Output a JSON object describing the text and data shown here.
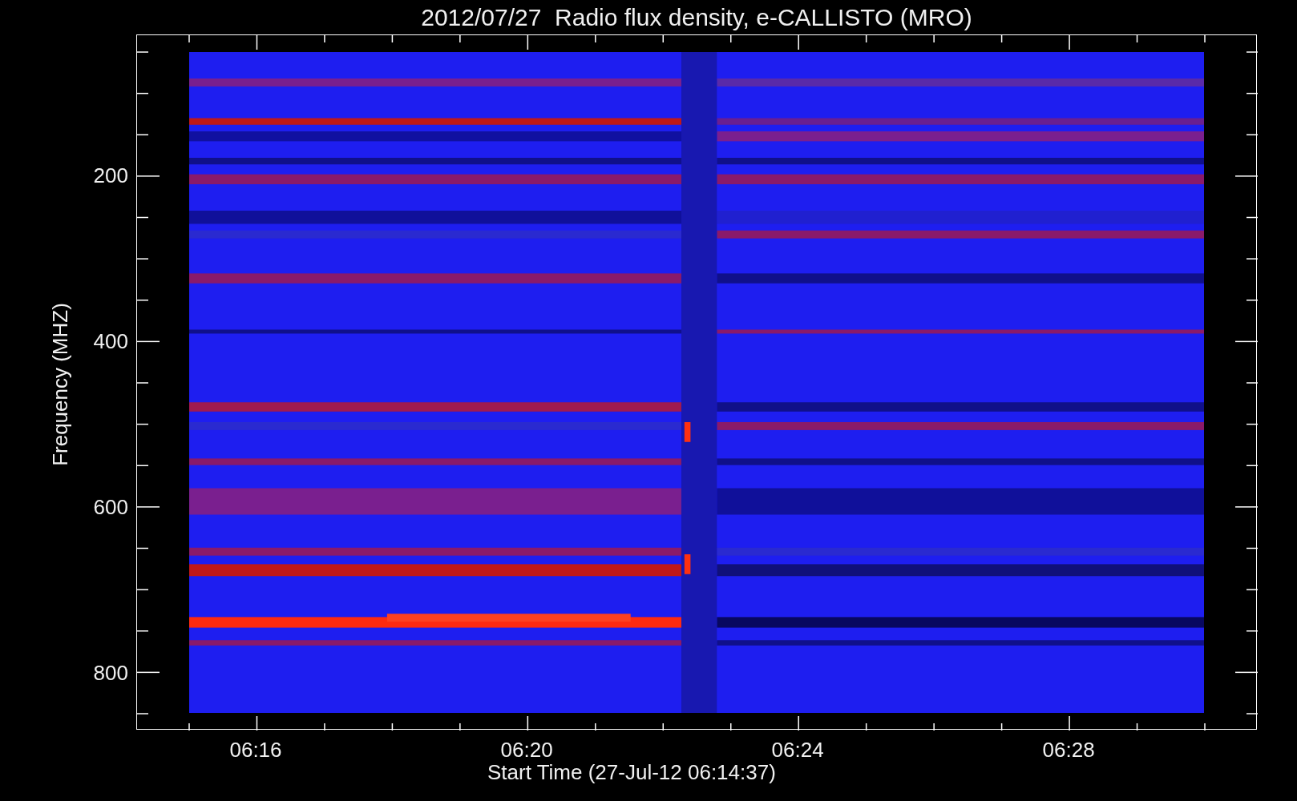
{
  "title": "2012/07/27  Radio flux density, e-CALLISTO (MRO)",
  "plot": {
    "ylabel": "Frequency (MHZ)",
    "xlabel": "Start Time (27-Jul-12 06:14:37)",
    "yticks": [
      {
        "label": "200"
      },
      {
        "label": "400"
      },
      {
        "label": "600"
      },
      {
        "label": "800"
      }
    ],
    "xticks": [
      {
        "label": "06:16"
      },
      {
        "label": "06:20"
      },
      {
        "label": "06:24"
      },
      {
        "label": "06:28"
      }
    ]
  }
}
